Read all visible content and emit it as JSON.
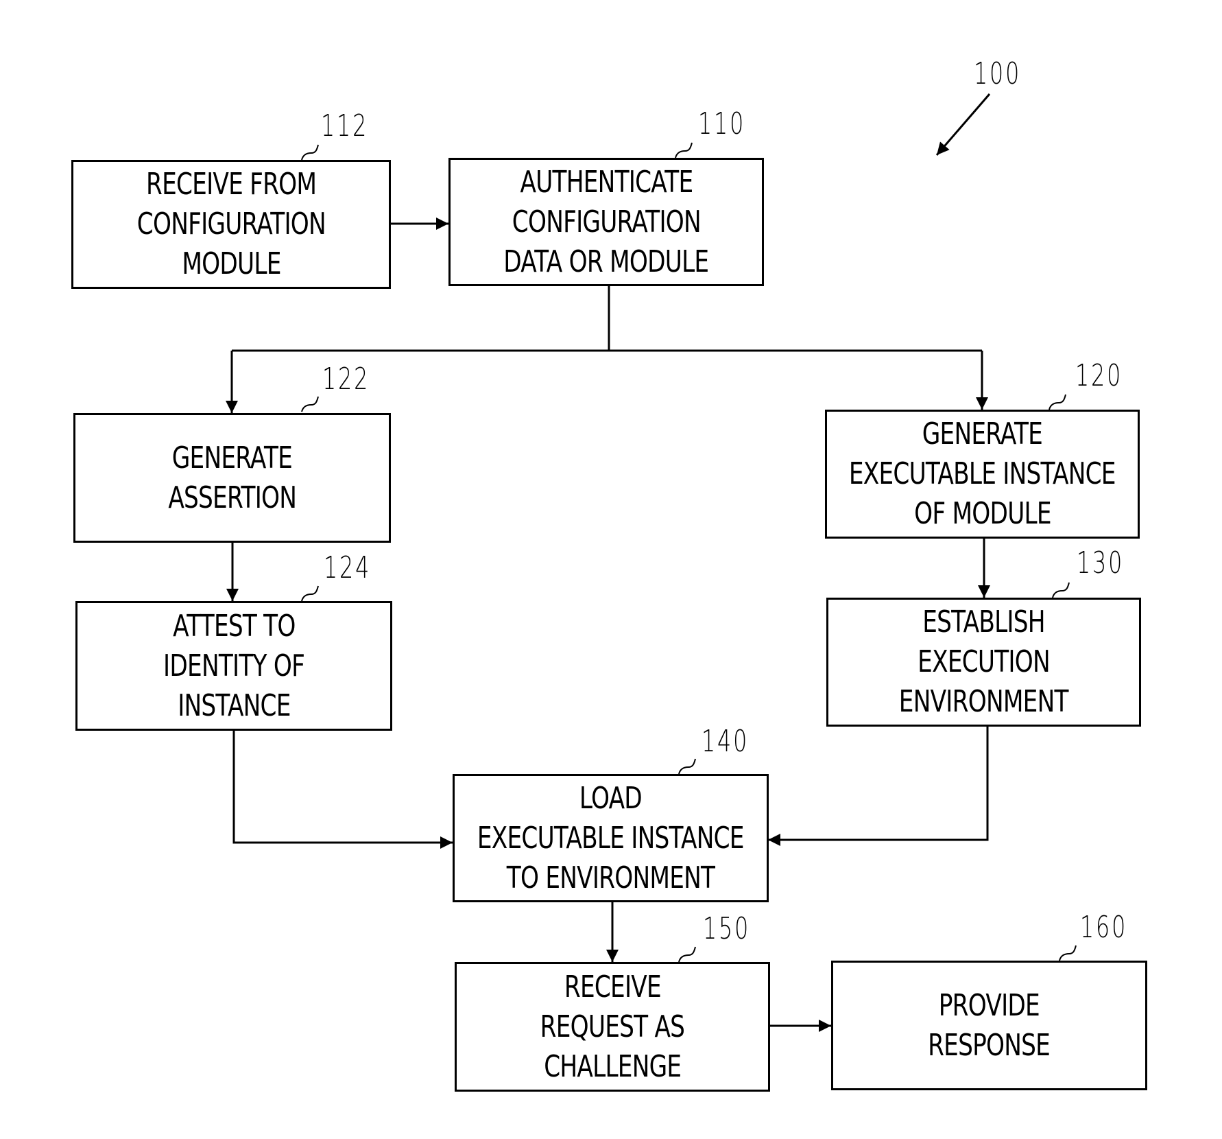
{
  "figure_ref": "100",
  "steps": [
    {
      "id": "112",
      "lines": [
        "RECEIVE FROM",
        "CONFIGURATION",
        "MODULE"
      ]
    },
    {
      "id": "110",
      "lines": [
        "AUTHENTICATE",
        "CONFIGURATION",
        "DATA OR MODULE"
      ]
    },
    {
      "id": "122",
      "lines": [
        "GENERATE",
        "ASSERTION"
      ]
    },
    {
      "id": "120",
      "lines": [
        "GENERATE",
        "EXECUTABLE INSTANCE",
        "OF MODULE"
      ]
    },
    {
      "id": "124",
      "lines": [
        "ATTEST TO",
        "IDENTITY OF",
        "INSTANCE"
      ]
    },
    {
      "id": "130",
      "lines": [
        "ESTABLISH",
        "EXECUTION",
        "ENVIRONMENT"
      ]
    },
    {
      "id": "140",
      "lines": [
        "LOAD",
        "EXECUTABLE INSTANCE",
        "TO ENVIRONMENT"
      ]
    },
    {
      "id": "150",
      "lines": [
        "RECEIVE",
        "REQUEST AS",
        "CHALLENGE"
      ]
    },
    {
      "id": "160",
      "lines": [
        "PROVIDE",
        "RESPONSE"
      ]
    }
  ],
  "connections": [
    {
      "from": "112",
      "to": "110"
    },
    {
      "from": "110",
      "to": "122"
    },
    {
      "from": "110",
      "to": "120"
    },
    {
      "from": "122",
      "to": "124"
    },
    {
      "from": "120",
      "to": "130"
    },
    {
      "from": "124",
      "to": "140"
    },
    {
      "from": "130",
      "to": "140"
    },
    {
      "from": "140",
      "to": "150"
    },
    {
      "from": "150",
      "to": "160"
    }
  ]
}
